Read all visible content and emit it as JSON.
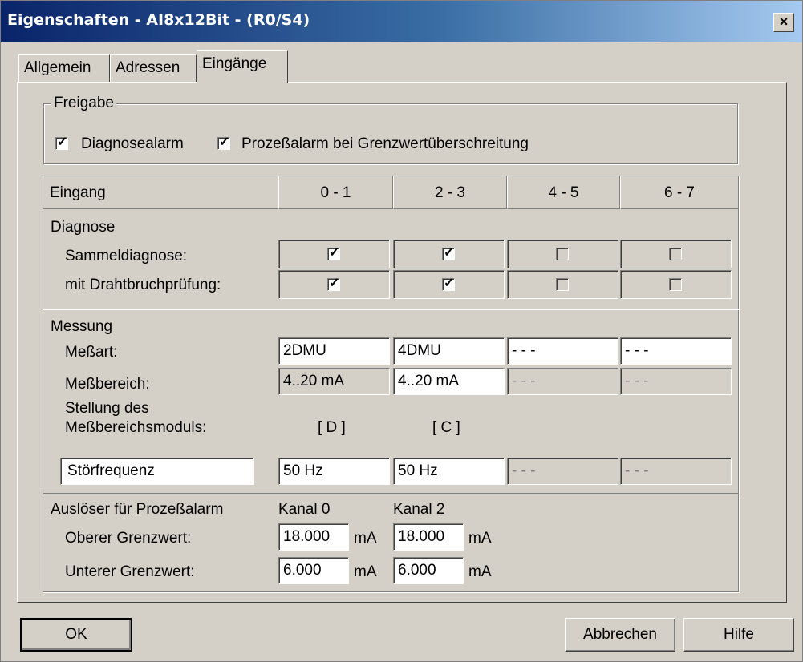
{
  "window": {
    "title": "Eigenschaften - AI8x12Bit - (R0/S4)",
    "close_glyph": "×"
  },
  "tabs": [
    {
      "label": "Allgemein"
    },
    {
      "label": "Adressen"
    },
    {
      "label": "Eingänge"
    }
  ],
  "freigabe": {
    "label": "Freigabe",
    "diagnosealarm": {
      "label": "Diagnosealarm",
      "checked": true
    },
    "prozessalarm": {
      "label": "Prozeßalarm bei Grenzwertüberschreitung",
      "checked": true
    }
  },
  "table": {
    "header_label": "Eingang",
    "columns": [
      "0 - 1",
      "2 - 3",
      "4 - 5",
      "6 - 7"
    ]
  },
  "diagnose": {
    "label": "Diagnose",
    "sammel_label": "Sammeldiagnose:",
    "draht_label": "mit Drahtbruchprüfung:",
    "sammel": [
      true,
      true,
      false,
      false
    ],
    "draht": [
      true,
      true,
      false,
      false
    ],
    "check_glyph": "✓"
  },
  "messung": {
    "label": "Messung",
    "messart_label": "Meßart:",
    "messart": [
      "2DMU",
      "4DMU",
      "- - -",
      "- - -"
    ],
    "messbereich_label": "Meßbereich:",
    "messbereich": [
      "4..20 mA",
      "4..20 mA",
      "- - -",
      "- - -"
    ],
    "stellung_label_1": "Stellung des",
    "stellung_label_2": "Meßbereichsmoduls:",
    "stellung": [
      "[ D ]",
      "[ C ]"
    ],
    "stoerfrequenz_label": "Störfrequenz",
    "stoerfrequenz": [
      "50 Hz",
      "50 Hz",
      "- - -",
      "- - -"
    ]
  },
  "prozessalarm_section": {
    "label": "Auslöser für Prozeßalarm",
    "kanal": [
      "Kanal 0",
      "Kanal 2"
    ],
    "oberer_label": "Oberer Grenzwert:",
    "oberer": [
      "18.000",
      "18.000"
    ],
    "unterer_label": "Unterer Grenzwert:",
    "unterer": [
      "6.000",
      "6.000"
    ],
    "unit": "mA"
  },
  "buttons": {
    "ok": "OK",
    "cancel": "Abbrechen",
    "help": "Hilfe"
  }
}
